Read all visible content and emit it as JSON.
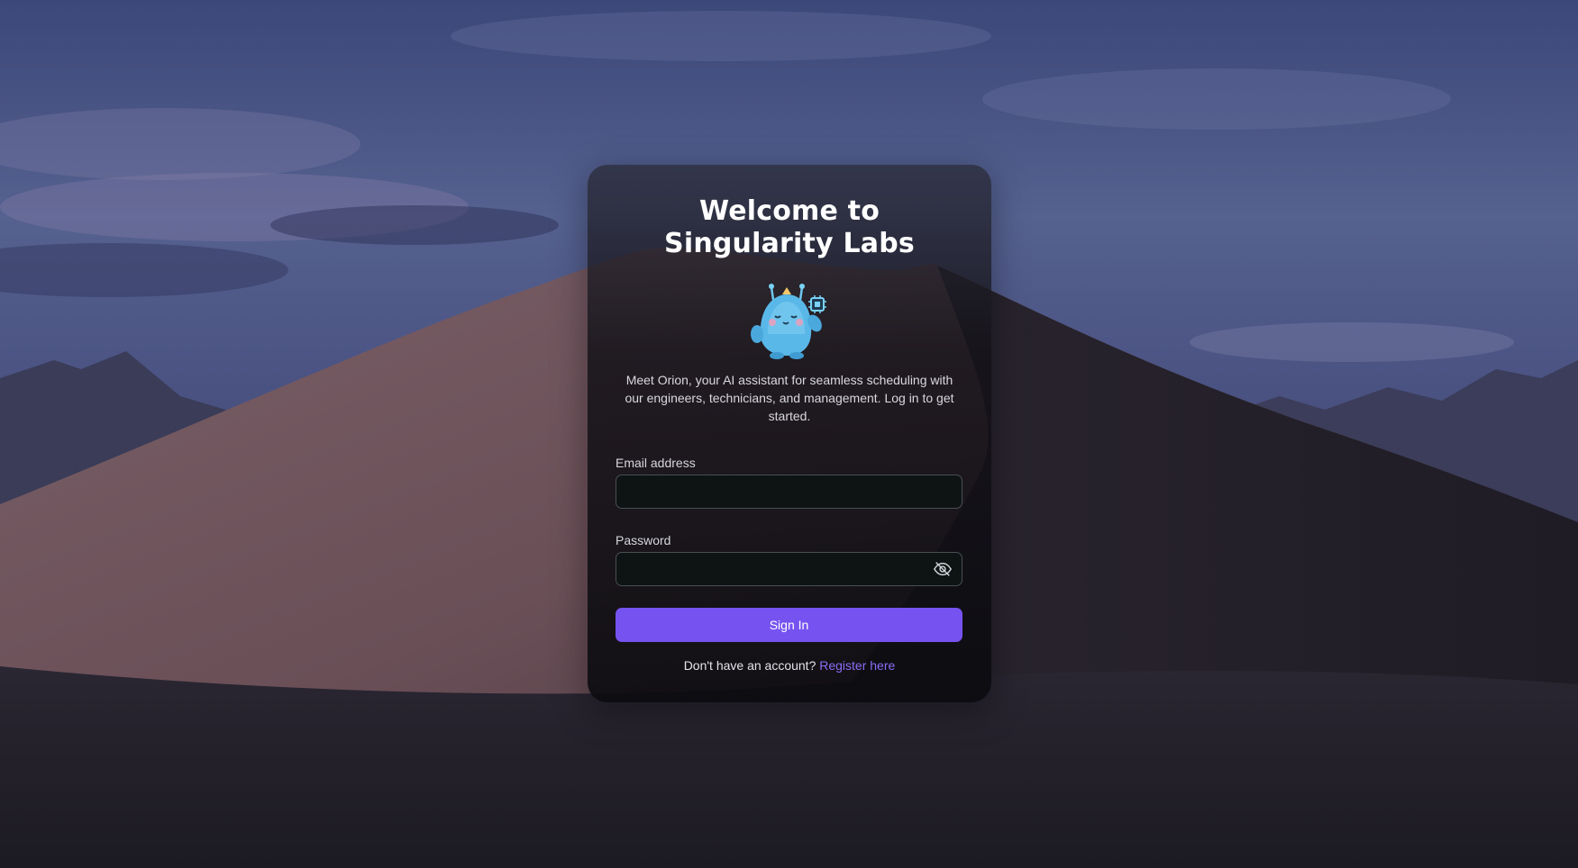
{
  "login": {
    "title": "Welcome to Singularity Labs",
    "mascot_icon": "robot-mascot-icon",
    "description": "Meet Orion, your AI assistant for seamless scheduling with our engineers, technicians, and management. Log in to get started.",
    "email_label": "Email address",
    "email_value": "",
    "password_label": "Password",
    "password_value": "",
    "password_toggle_icon": "eye-off-icon",
    "signin_label": "Sign In",
    "register_prompt": "Don't have an account?",
    "register_link": "Register here"
  },
  "colors": {
    "accent": "#7653f0",
    "link": "#8a6cf5",
    "input_bg": "#0e1313",
    "input_border": "#4a4f55"
  }
}
